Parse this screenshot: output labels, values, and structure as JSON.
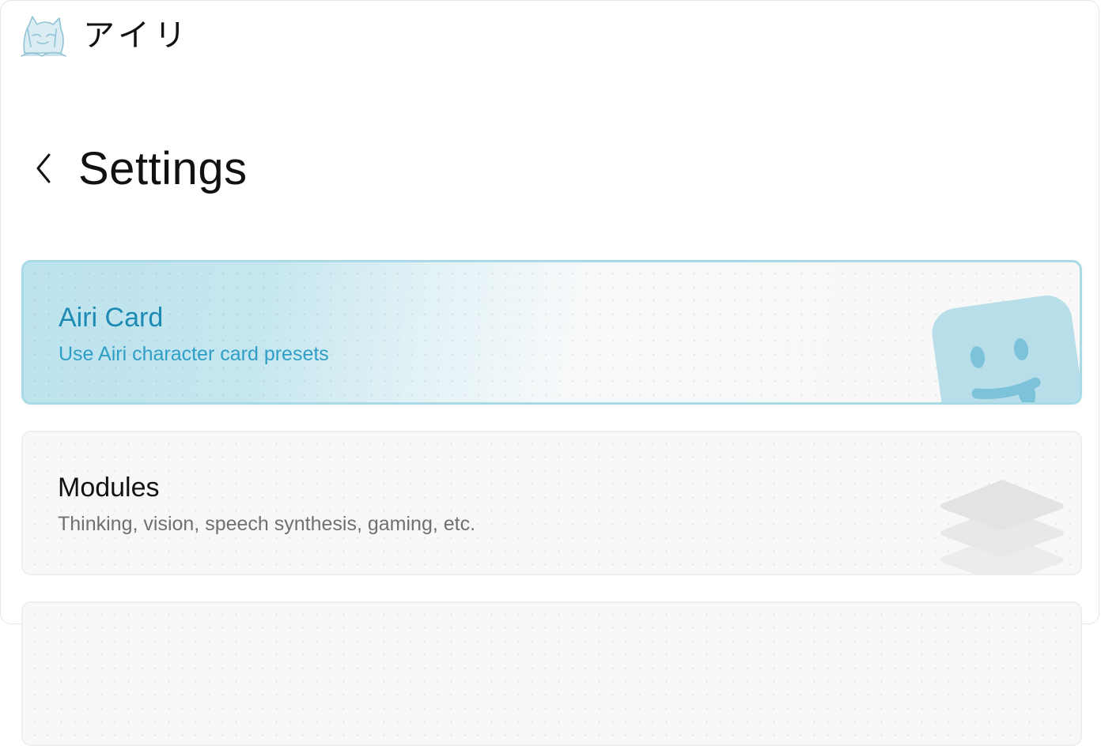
{
  "brand": {
    "name": "アイリ",
    "logo_icon": "anime-character-logo-icon"
  },
  "header": {
    "title": "Settings",
    "back_icon": "chevron-left-icon"
  },
  "cards": [
    {
      "id": "airi-card",
      "title": "Airi Card",
      "description": "Use Airi character card presets",
      "icon": "smiley-sticker-icon",
      "active": true
    },
    {
      "id": "modules",
      "title": "Modules",
      "description": "Thinking, vision, speech synthesis, gaming, etc.",
      "icon": "layers-stack-icon",
      "active": false
    }
  ],
  "colors": {
    "accent": "#1d8ab4",
    "accent_light": "#bde3ee",
    "accent_border": "#a9dbe7",
    "card_bg": "#f8f8f8",
    "text_muted": "#707070"
  }
}
